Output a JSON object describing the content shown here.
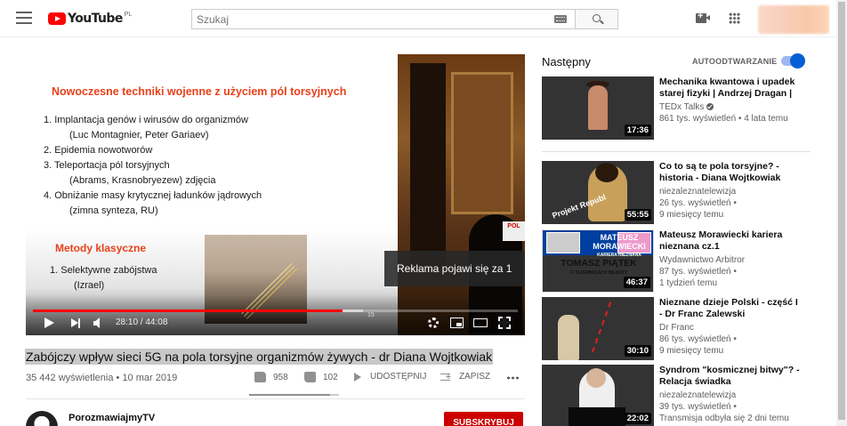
{
  "header": {
    "logo_text": "YouTube",
    "logo_country": "PL",
    "search_placeholder": "Szukaj"
  },
  "player": {
    "slide": {
      "title": "Nowoczesne techniki wojenne z użyciem pól torsyjnych",
      "items": [
        {
          "text": "1. Implantacja genów i wirusów do organizmów",
          "sub": false
        },
        {
          "text": "(Luc Montagnier, Peter Gariaev)",
          "sub": true
        },
        {
          "text": "2. Epidemia nowotworów",
          "sub": false
        },
        {
          "text": "3. Teleportacja pól torsyjnych",
          "sub": false
        },
        {
          "text": "(Abrams, Krasnobryezew) zdjęcia",
          "sub": true
        },
        {
          "text": "4. Obniżanie masy krytycznej ładunków jądrowych",
          "sub": false
        },
        {
          "text": "(zimna synteza, RU)",
          "sub": true
        }
      ],
      "title2": "Metody klasyczne",
      "items2": [
        {
          "text": "1. Selektywne zabójstwa",
          "sub": false
        },
        {
          "text": "(Izrael)",
          "sub": true
        }
      ],
      "stage_sign": "POL",
      "chapter_marker": "15"
    },
    "ad_notice": "Reklama pojawi się za 1",
    "time": "28:10 / 44:08",
    "progress_played": 0.6383,
    "progress_buffered": 0.68
  },
  "video": {
    "title": "Zabójczy wpływ sieci 5G na pola torsyjne organizmów żywych - dr Diana Wojtkowiak",
    "views": "35 442 wyświetlenia",
    "date": "10 mar 2019",
    "likes": "958",
    "dislikes": "102",
    "share_label": "UDOSTĘPNIJ",
    "save_label": "ZAPISZ",
    "like_ratio": 0.9038
  },
  "channel": {
    "name": "PorozmawiajmyTV",
    "subscribe_label": "SUBSKRYBUJ"
  },
  "sidebar": {
    "next_label": "Następny",
    "autoplay_label": "AUTOODTWARZANIE",
    "autoplay_on": true,
    "items": [
      {
        "title": "Mechanika kwantowa i upadek starej fizyki | Andrzej Dragan | ...",
        "channel": "TEDx Talks",
        "verified": true,
        "views": "861 tys. wyświetleń • 4 lata temu",
        "age": "",
        "duration": "17:36"
      },
      {
        "title": "Co to są te pola torsyjne? - historia - Diana Wojtkowiak",
        "channel": "niezaleznatelewizja",
        "verified": false,
        "views": "26 tys. wyświetleń •",
        "age": "9 miesięcy temu",
        "duration": "55:55",
        "thumb_text": "Projekt Republ"
      },
      {
        "title": "Mateusz Morawiecki kariera nieznana cz.1",
        "channel": "Wydawnictwo Arbitror",
        "verified": false,
        "views": "87 tys. wyświetleń •",
        "age": "1 tydzień temu",
        "duration": "46:37",
        "thumb_top": "MATEUSZ MORAWIECKI",
        "thumb_top_sub": "KARIERA NIEZNANA",
        "thumb_bottom": "TOMASZ PIĄTEK",
        "thumb_bottom_sub": "O TAJEMNICACH WŁADZY"
      },
      {
        "title": "Nieznane dzieje Polski - część I - Dr Franc Zalewski",
        "channel": "Dr Franc",
        "verified": false,
        "views": "86 tys. wyświetleń •",
        "age": "9 miesięcy temu",
        "duration": "30:10"
      },
      {
        "title": "Syndrom \"kosmicznej bitwy\"? - Relacja świadka",
        "channel": "niezaleznatelewizja",
        "verified": false,
        "views": "39 tys. wyświetleń •",
        "age": "Transmisja odbyła się 2 dni temu",
        "duration": "22:02"
      }
    ]
  }
}
